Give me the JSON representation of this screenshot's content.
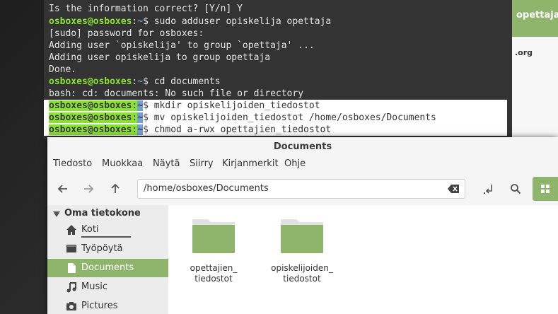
{
  "colors": {
    "accent": "#8fb56c",
    "prompt_user": "#8ae234",
    "prompt_path": "#729fcf",
    "terminal_bg": "#333333"
  },
  "background_window": {
    "heading": "opettaja",
    "link": ".org"
  },
  "terminal": {
    "lines": [
      {
        "text": "Is the information correct? [Y/n] Y"
      },
      {
        "user": "osboxes@osboxes",
        "sep": ":",
        "path": "~",
        "cmd": "$ sudo adduser opiskelija opettaja"
      },
      {
        "text": "[sudo] password for osboxes:"
      },
      {
        "text": "Adding user `opiskelija' to group `opettaja' ..."
      },
      {
        "text": "Adding user opiskelija to group opettaja"
      },
      {
        "text": "Done."
      },
      {
        "user": "osboxes@osboxes",
        "sep": ":",
        "path": "~",
        "cmd": "$ cd documents"
      },
      {
        "text": "bash: cd: documents: No such file or directory"
      },
      {
        "user": "osboxes@osboxes",
        "sep": ":",
        "path": "~",
        "cmd": "$ mkdir opiskelijoiden_tiedostot"
      },
      {
        "user": "osboxes@osboxes",
        "sep": ":",
        "path": "~",
        "cmd": "$ mv opiskelijoiden_tiedostot /home/osboxes/Documents"
      },
      {
        "user": "osboxes@osboxes",
        "sep": ":",
        "path": "~",
        "cmd": "$ chmod a-rwx opettajien_tiedostot"
      }
    ]
  },
  "file_manager": {
    "title": "Documents",
    "menu": [
      "Tiedosto",
      "Muokkaa",
      "Näytä",
      "Siirry",
      "Kirjanmerkit",
      "Ohje"
    ],
    "toolbar": {
      "back_icon": "arrow-left-icon",
      "forward_icon": "arrow-right-icon",
      "up_icon": "arrow-up-icon",
      "path": "/home/osboxes/Documents",
      "clear_icon": "clear-icon",
      "toggle_icon": "toggle-location-icon",
      "search_icon": "search-icon",
      "view_icon": "grid-view-icon"
    },
    "sidebar": {
      "heading": "Oma tietokone",
      "items": [
        {
          "label": "Koti",
          "icon": "home-icon"
        },
        {
          "label": "Työpöytä",
          "icon": "desktop-icon"
        },
        {
          "label": "Documents",
          "icon": "document-icon",
          "active": true
        },
        {
          "label": "Music",
          "icon": "music-icon"
        },
        {
          "label": "Pictures",
          "icon": "camera-icon"
        }
      ]
    },
    "folders": [
      {
        "name_line1": "opettajien_",
        "name_line2": "tiedostot"
      },
      {
        "name_line1": "opiskelijoiden_",
        "name_line2": "tiedostot"
      }
    ]
  }
}
